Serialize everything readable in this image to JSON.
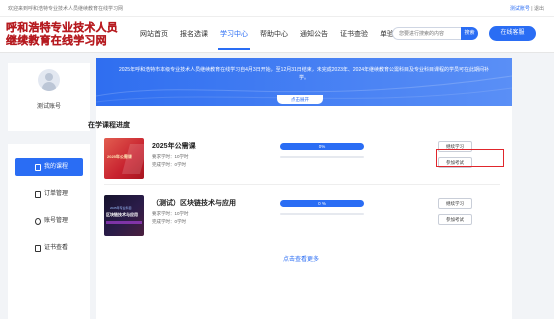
{
  "topbar": {
    "welcome": "欢迎来到呼和浩特专业技术人员继续教育在线学习网",
    "user_name": "测试账号",
    "separator": " | ",
    "logout": "退出"
  },
  "logo": {
    "line1": "呼和浩特专业技术人员",
    "line2": "继续教育在线学习网"
  },
  "nav": {
    "items": [
      "网站首页",
      "报名选课",
      "学习中心",
      "帮助中心",
      "通知公告",
      "证书查验",
      "单验卡"
    ],
    "active_index": 2
  },
  "search": {
    "placeholder": "您要进行搜索的内容",
    "button": "搜索"
  },
  "consult_button": "在线客服",
  "profile": {
    "name": "测试账号"
  },
  "side_menu": {
    "items": [
      "我的课程",
      "订单管理",
      "账号管理",
      "证书查看"
    ],
    "active_index": 0
  },
  "banner": {
    "notice": "2025年呼和浩特市本级专业技术人员继续教育在线学习自4月3日开始，至12月31日结束，未完成2023年、2024年继续教育公需科目及专业科目课程的学员可在此期间补学。",
    "expand": "点击展开"
  },
  "section_title": "在学课程进度",
  "courses": [
    {
      "thumb_text": "2025年公需课",
      "name": "2025年公需课",
      "required": "要求学时：10学时",
      "completed": "完成学时：0学时",
      "progress_text": "0%",
      "progress": 0,
      "study_button": "继续学习",
      "exam_button": "参加考试"
    },
    {
      "thumb_sub": "2025年专业科目",
      "thumb_text": "区块链技术与应用",
      "name": "（测试）区块链技术与应用",
      "required": "要求学时：10学时",
      "completed": "完成学时：0学时",
      "progress_text": "0 %",
      "progress": 0,
      "study_button": "继续学习",
      "exam_button": "参加考试"
    }
  ],
  "more_link": "点击查看更多",
  "colors": {
    "primary": "#2a6df4",
    "highlight": "#e0262c",
    "logo": "#d8262c"
  }
}
